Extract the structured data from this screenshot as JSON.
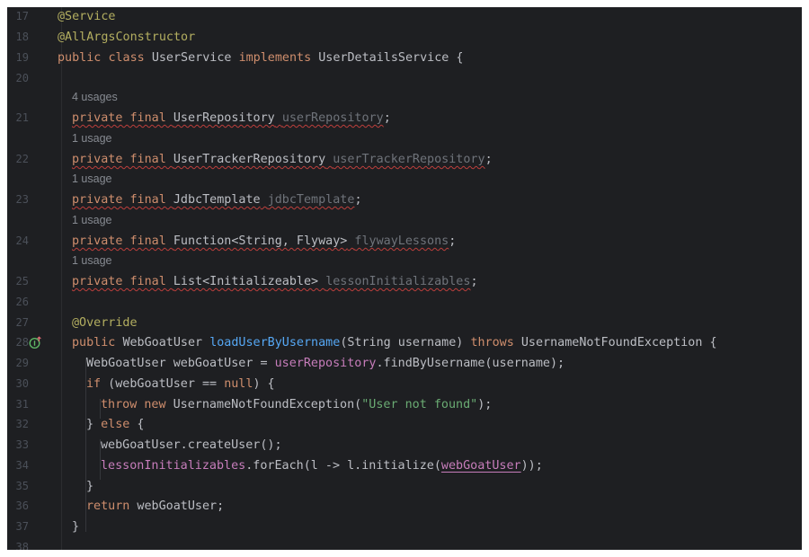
{
  "editor": {
    "lines": {
      "l17": {
        "num": "17",
        "anno": "@Service"
      },
      "l18": {
        "num": "18",
        "anno": "@AllArgsConstructor"
      },
      "l19": {
        "num": "19",
        "kw1": "public",
        "kw2": "class",
        "name": "UserService",
        "kw3": "implements",
        "iface": "UserDetailsService {"
      },
      "l20": {
        "num": "20"
      },
      "l21": {
        "num": "21",
        "usage": "4 usages",
        "mods": "private final",
        "type": "UserRepository",
        "field": "userRepository",
        "end": ";"
      },
      "l22": {
        "num": "22",
        "usage": "1 usage",
        "mods": "private final",
        "type": "UserTrackerRepository",
        "field": "userTrackerRepository",
        "end": ";"
      },
      "l23": {
        "num": "23",
        "usage": "1 usage",
        "mods": "private final",
        "type": "JdbcTemplate",
        "field": "jdbcTemplate",
        "end": ";"
      },
      "l24": {
        "num": "24",
        "usage": "1 usage",
        "mods": "private final",
        "type": "Function<String, Flyway>",
        "field": "flywayLessons",
        "end": ";"
      },
      "l25": {
        "num": "25",
        "usage": "1 usage",
        "mods": "private final",
        "type": "List<Initializeable>",
        "field": "lessonInitializables",
        "end": ";"
      },
      "l26": {
        "num": "26"
      },
      "l27": {
        "num": "27",
        "anno": "@Override"
      },
      "l28": {
        "num": "28",
        "kw1": "public",
        "t1": "WebGoatUser",
        "method": "loadUserByUsername",
        "params": "(String username)",
        "kw2": "throws",
        "t2": "UsernameNotFoundException {"
      },
      "l29": {
        "num": "29",
        "t1": "WebGoatUser webGoatUser = ",
        "field": "userRepository",
        "t2": ".findByUsername(username);"
      },
      "l30": {
        "num": "30",
        "kw": "if",
        "t1": " (webGoatUser == ",
        "kw2": "null",
        "t2": ") {"
      },
      "l31": {
        "num": "31",
        "kw": "throw new",
        "t1": " UsernameNotFoundException(",
        "str": "\"User not found\"",
        "t2": ");"
      },
      "l32": {
        "num": "32",
        "t1": "} ",
        "kw": "else",
        "t2": " {"
      },
      "l33": {
        "num": "33",
        "t1": "webGoatUser.createUser();"
      },
      "l34": {
        "num": "34",
        "field": "lessonInitializables",
        "t1": ".forEach(l -> l.initialize(",
        "field2": "webGoatUser",
        "t2": "));"
      },
      "l35": {
        "num": "35",
        "t1": "}"
      },
      "l36": {
        "num": "36",
        "kw": "return",
        "t1": " webGoatUser;"
      },
      "l37": {
        "num": "37",
        "t1": "}"
      },
      "l38": {
        "num": "38"
      }
    },
    "gutter_icon": "implements-method-icon",
    "colors": {
      "background": "#1e1f22",
      "keyword": "#cf8e6d",
      "annotation": "#b3ae60",
      "method": "#56a8f5",
      "field": "#c77dbb",
      "string": "#6aab73",
      "unused": "#6f737a",
      "line_number": "#4b5059"
    }
  }
}
